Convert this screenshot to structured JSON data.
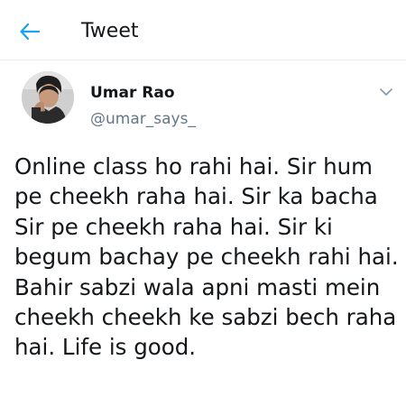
{
  "header": {
    "back_icon": "arrow-left-icon",
    "title": "Tweet"
  },
  "tweet": {
    "author_name": "Umar Rao",
    "author_handle": "@umar_says_",
    "menu_icon": "chevron-down-icon",
    "text": "Online class ho rahi hai. Sir hum\npe cheekh raha hai. Sir ka bacha\nSir pe cheekh raha hai. Sir ki\nbegum bachay pe cheekh rahi hai.\nBahir sabzi wala apni masti mein\ncheekh cheekh ke sabzi bech raha\nhai. Life is good."
  },
  "colors": {
    "accent": "#1da1f2",
    "text": "#14171a",
    "secondary_text": "#657786",
    "divider": "#e6ecf0"
  }
}
